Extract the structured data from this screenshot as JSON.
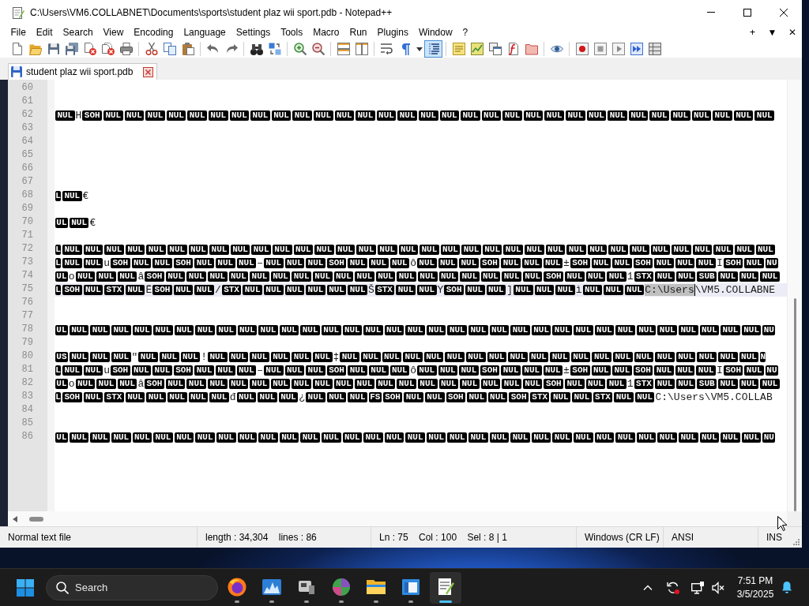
{
  "window": {
    "title": "C:\\Users\\VM6.COLLABNET\\Documents\\sports\\student plaz wii sport.pdb - Notepad++"
  },
  "menu_bar": {
    "items": [
      "File",
      "Edit",
      "Search",
      "View",
      "Encoding",
      "Language",
      "Settings",
      "Tools",
      "Macro",
      "Run",
      "Plugins",
      "Window",
      "?"
    ],
    "window_controls": [
      "+",
      "▼",
      "✕"
    ]
  },
  "toolbar": {
    "buttons": [
      {
        "pressed": false
      },
      {
        "pressed": false
      },
      {
        "pressed": false
      },
      {
        "pressed": false
      },
      {
        "pressed": false
      },
      {
        "pressed": false
      },
      {
        "pressed": false
      },
      {
        "pressed": false
      },
      {
        "pressed": false
      },
      {
        "pressed": false
      },
      {
        "pressed": false
      },
      {
        "pressed": false
      },
      {
        "pressed": false
      },
      {
        "pressed": false
      },
      {
        "pressed": false
      },
      {
        "pressed": false
      },
      {
        "pressed": false
      },
      {
        "pressed": false
      },
      {
        "pressed": false
      },
      {
        "pressed": false
      },
      {
        "pressed": false
      },
      {
        "pressed": true
      },
      {
        "pressed": false
      },
      {
        "pressed": false
      },
      {
        "pressed": false
      },
      {
        "pressed": false
      },
      {
        "pressed": false
      },
      {
        "pressed": false
      },
      {
        "pressed": false
      },
      {
        "pressed": false
      },
      {
        "pressed": false
      },
      {
        "pressed": false
      },
      {
        "pressed": false
      }
    ]
  },
  "tabs": [
    {
      "label": "student plaz wii sport.pdb",
      "selected": true
    }
  ],
  "editor": {
    "lines": [
      {
        "number": "60",
        "current": false
      },
      {
        "number": "61",
        "current": false
      },
      {
        "number": "62",
        "current": false,
        "tokens": [
          {
            "kind": "control",
            "text": "NUL"
          },
          {
            "kind": "text",
            "text": "H"
          },
          {
            "kind": "control",
            "text": "SOH"
          },
          {
            "kind": "control",
            "text": "NUL"
          },
          {
            "kind": "control",
            "text": "NUL"
          },
          {
            "kind": "control",
            "text": "NUL"
          },
          {
            "kind": "control",
            "text": "NUL"
          },
          {
            "kind": "control",
            "text": "NUL"
          },
          {
            "kind": "control",
            "text": "NUL"
          },
          {
            "kind": "control",
            "text": "NUL"
          },
          {
            "kind": "control",
            "text": "NUL"
          },
          {
            "kind": "control",
            "text": "NUL"
          },
          {
            "kind": "control",
            "text": "NUL"
          },
          {
            "kind": "control",
            "text": "NUL"
          },
          {
            "kind": "control",
            "text": "NUL"
          },
          {
            "kind": "control",
            "text": "NUL"
          },
          {
            "kind": "control",
            "text": "NUL"
          },
          {
            "kind": "control",
            "text": "NUL"
          },
          {
            "kind": "control",
            "text": "NUL"
          },
          {
            "kind": "control",
            "text": "NUL"
          },
          {
            "kind": "control",
            "text": "NUL"
          },
          {
            "kind": "control",
            "text": "NUL"
          },
          {
            "kind": "control",
            "text": "NUL"
          },
          {
            "kind": "control",
            "text": "NUL"
          },
          {
            "kind": "control",
            "text": "NUL"
          },
          {
            "kind": "control",
            "text": "NUL"
          },
          {
            "kind": "control",
            "text": "NUL"
          },
          {
            "kind": "control",
            "text": "NUL"
          },
          {
            "kind": "control",
            "text": "NUL"
          },
          {
            "kind": "control",
            "text": "NUL"
          },
          {
            "kind": "control",
            "text": "NUL"
          },
          {
            "kind": "control",
            "text": "NUL"
          },
          {
            "kind": "control",
            "text": "NUL"
          },
          {
            "kind": "control",
            "text": "NUL"
          },
          {
            "kind": "control",
            "text": "NUL"
          }
        ]
      },
      {
        "number": "63",
        "current": false
      },
      {
        "number": "64",
        "current": false
      },
      {
        "number": "65",
        "current": false
      },
      {
        "number": "66",
        "current": false
      },
      {
        "number": "67",
        "current": false
      },
      {
        "number": "68",
        "current": false,
        "tokens": [
          {
            "kind": "control",
            "text": "L"
          },
          {
            "kind": "control",
            "text": "NUL"
          },
          {
            "kind": "text",
            "text": "€"
          }
        ]
      },
      {
        "number": "69",
        "current": false
      },
      {
        "number": "70",
        "current": false,
        "tokens": [
          {
            "kind": "control",
            "text": "UL"
          },
          {
            "kind": "control",
            "text": "NUL"
          },
          {
            "kind": "text",
            "text": "€"
          }
        ]
      },
      {
        "number": "71",
        "current": false
      },
      {
        "number": "72",
        "current": false,
        "tokens": [
          {
            "kind": "control",
            "text": "L"
          },
          {
            "kind": "control",
            "text": "NUL"
          },
          {
            "kind": "control",
            "text": "NUL"
          },
          {
            "kind": "control",
            "text": "NUL"
          },
          {
            "kind": "control",
            "text": "NUL"
          },
          {
            "kind": "control",
            "text": "NUL"
          },
          {
            "kind": "control",
            "text": "NUL"
          },
          {
            "kind": "control",
            "text": "NUL"
          },
          {
            "kind": "control",
            "text": "NUL"
          },
          {
            "kind": "control",
            "text": "NUL"
          },
          {
            "kind": "control",
            "text": "NUL"
          },
          {
            "kind": "control",
            "text": "NUL"
          },
          {
            "kind": "control",
            "text": "NUL"
          },
          {
            "kind": "control",
            "text": "NUL"
          },
          {
            "kind": "control",
            "text": "NUL"
          },
          {
            "kind": "control",
            "text": "NUL"
          },
          {
            "kind": "control",
            "text": "NUL"
          },
          {
            "kind": "control",
            "text": "NUL"
          },
          {
            "kind": "control",
            "text": "NUL"
          },
          {
            "kind": "control",
            "text": "NUL"
          },
          {
            "kind": "control",
            "text": "NUL"
          },
          {
            "kind": "control",
            "text": "NUL"
          },
          {
            "kind": "control",
            "text": "NUL"
          },
          {
            "kind": "control",
            "text": "NUL"
          },
          {
            "kind": "control",
            "text": "NUL"
          },
          {
            "kind": "control",
            "text": "NUL"
          },
          {
            "kind": "control",
            "text": "NUL"
          },
          {
            "kind": "control",
            "text": "NUL"
          },
          {
            "kind": "control",
            "text": "NUL"
          },
          {
            "kind": "control",
            "text": "NUL"
          },
          {
            "kind": "control",
            "text": "NUL"
          },
          {
            "kind": "control",
            "text": "NUL"
          },
          {
            "kind": "control",
            "text": "NUL"
          },
          {
            "kind": "control",
            "text": "NUL"
          },
          {
            "kind": "control",
            "text": "NUL"
          }
        ]
      },
      {
        "number": "73",
        "current": false,
        "tokens": [
          {
            "kind": "control",
            "text": "L"
          },
          {
            "kind": "control",
            "text": "NUL"
          },
          {
            "kind": "control",
            "text": "NUL"
          },
          {
            "kind": "text",
            "text": "u"
          },
          {
            "kind": "control",
            "text": "SOH"
          },
          {
            "kind": "control",
            "text": "NUL"
          },
          {
            "kind": "control",
            "text": "NUL"
          },
          {
            "kind": "control",
            "text": "SOH"
          },
          {
            "kind": "control",
            "text": "NUL"
          },
          {
            "kind": "control",
            "text": "NUL"
          },
          {
            "kind": "control",
            "text": "NUL"
          },
          {
            "kind": "text",
            "text": "–"
          },
          {
            "kind": "control",
            "text": "NUL"
          },
          {
            "kind": "control",
            "text": "NUL"
          },
          {
            "kind": "control",
            "text": "NUL"
          },
          {
            "kind": "control",
            "text": "SOH"
          },
          {
            "kind": "control",
            "text": "NUL"
          },
          {
            "kind": "control",
            "text": "NUL"
          },
          {
            "kind": "control",
            "text": "NUL"
          },
          {
            "kind": "text",
            "text": "ô"
          },
          {
            "kind": "control",
            "text": "NUL"
          },
          {
            "kind": "control",
            "text": "NUL"
          },
          {
            "kind": "control",
            "text": "NUL"
          },
          {
            "kind": "control",
            "text": "SOH"
          },
          {
            "kind": "control",
            "text": "NUL"
          },
          {
            "kind": "control",
            "text": "NUL"
          },
          {
            "kind": "control",
            "text": "NUL"
          },
          {
            "kind": "text",
            "text": "±"
          },
          {
            "kind": "control",
            "text": "SOH"
          },
          {
            "kind": "control",
            "text": "NUL"
          },
          {
            "kind": "control",
            "text": "NUL"
          },
          {
            "kind": "control",
            "text": "SOH"
          },
          {
            "kind": "control",
            "text": "NUL"
          },
          {
            "kind": "control",
            "text": "NUL"
          },
          {
            "kind": "control",
            "text": "NUL"
          },
          {
            "kind": "text",
            "text": "I"
          },
          {
            "kind": "control",
            "text": "SOH"
          },
          {
            "kind": "control",
            "text": "NUL"
          },
          {
            "kind": "control",
            "text": "NU"
          }
        ]
      },
      {
        "number": "74",
        "current": false,
        "tokens": [
          {
            "kind": "control",
            "text": "UL"
          },
          {
            "kind": "text",
            "text": "o"
          },
          {
            "kind": "control",
            "text": "NUL"
          },
          {
            "kind": "control",
            "text": "NUL"
          },
          {
            "kind": "control",
            "text": "NUL"
          },
          {
            "kind": "text",
            "text": "â"
          },
          {
            "kind": "control",
            "text": "SOH"
          },
          {
            "kind": "control",
            "text": "NUL"
          },
          {
            "kind": "control",
            "text": "NUL"
          },
          {
            "kind": "control",
            "text": "NUL"
          },
          {
            "kind": "control",
            "text": "NUL"
          },
          {
            "kind": "control",
            "text": "NUL"
          },
          {
            "kind": "control",
            "text": "NUL"
          },
          {
            "kind": "control",
            "text": "NUL"
          },
          {
            "kind": "control",
            "text": "NUL"
          },
          {
            "kind": "control",
            "text": "NUL"
          },
          {
            "kind": "control",
            "text": "NUL"
          },
          {
            "kind": "control",
            "text": "NUL"
          },
          {
            "kind": "control",
            "text": "NUL"
          },
          {
            "kind": "control",
            "text": "NUL"
          },
          {
            "kind": "control",
            "text": "NUL"
          },
          {
            "kind": "control",
            "text": "NUL"
          },
          {
            "kind": "control",
            "text": "NUL"
          },
          {
            "kind": "control",
            "text": "NUL"
          },
          {
            "kind": "control",
            "text": "NUL"
          },
          {
            "kind": "control",
            "text": "SOH"
          },
          {
            "kind": "control",
            "text": "NUL"
          },
          {
            "kind": "control",
            "text": "NUL"
          },
          {
            "kind": "control",
            "text": "NUL"
          },
          {
            "kind": "text",
            "text": "1"
          },
          {
            "kind": "control",
            "text": "STX"
          },
          {
            "kind": "control",
            "text": "NUL"
          },
          {
            "kind": "control",
            "text": "NUL"
          },
          {
            "kind": "control",
            "text": "SUB"
          },
          {
            "kind": "control",
            "text": "NUL"
          },
          {
            "kind": "control",
            "text": "NUL"
          },
          {
            "kind": "control",
            "text": "NUL"
          }
        ]
      },
      {
        "number": "75",
        "current": true,
        "tokens": [
          {
            "kind": "control",
            "text": "L"
          },
          {
            "kind": "control",
            "text": "SOH"
          },
          {
            "kind": "control",
            "text": "NUL"
          },
          {
            "kind": "control",
            "text": "STX"
          },
          {
            "kind": "control",
            "text": "NUL"
          },
          {
            "kind": "text",
            "text": "Ë"
          },
          {
            "kind": "control",
            "text": "SOH"
          },
          {
            "kind": "control",
            "text": "NUL"
          },
          {
            "kind": "control",
            "text": "NUL"
          },
          {
            "kind": "text",
            "text": "/"
          },
          {
            "kind": "control",
            "text": "STX"
          },
          {
            "kind": "control",
            "text": "NUL"
          },
          {
            "kind": "control",
            "text": "NUL"
          },
          {
            "kind": "control",
            "text": "NUL"
          },
          {
            "kind": "control",
            "text": "NUL"
          },
          {
            "kind": "control",
            "text": "NUL"
          },
          {
            "kind": "control",
            "text": "NUL"
          },
          {
            "kind": "text",
            "text": "Š"
          },
          {
            "kind": "control",
            "text": "STX"
          },
          {
            "kind": "control",
            "text": "NUL"
          },
          {
            "kind": "control",
            "text": "NUL"
          },
          {
            "kind": "text",
            "text": "Y"
          },
          {
            "kind": "control",
            "text": "SOH"
          },
          {
            "kind": "control",
            "text": "NUL"
          },
          {
            "kind": "control",
            "text": "NUL"
          },
          {
            "kind": "text",
            "text": "]"
          },
          {
            "kind": "control",
            "text": "NUL"
          },
          {
            "kind": "control",
            "text": "NUL"
          },
          {
            "kind": "control",
            "text": "NUL"
          },
          {
            "kind": "text",
            "text": "ì"
          },
          {
            "kind": "control",
            "text": "NUL"
          },
          {
            "kind": "control",
            "text": "NUL"
          },
          {
            "kind": "control",
            "text": "NUL"
          },
          {
            "kind": "selected_text",
            "text": "C:\\Users"
          },
          {
            "kind": "caret"
          },
          {
            "kind": "text",
            "text": "\\VM5.COLLABNE"
          }
        ]
      },
      {
        "number": "76",
        "current": false
      },
      {
        "number": "77",
        "current": false
      },
      {
        "number": "78",
        "current": false,
        "tokens": [
          {
            "kind": "control",
            "text": "UL"
          },
          {
            "kind": "control",
            "text": "NUL"
          },
          {
            "kind": "control",
            "text": "NUL"
          },
          {
            "kind": "control",
            "text": "NUL"
          },
          {
            "kind": "control",
            "text": "NUL"
          },
          {
            "kind": "control",
            "text": "NUL"
          },
          {
            "kind": "control",
            "text": "NUL"
          },
          {
            "kind": "control",
            "text": "NUL"
          },
          {
            "kind": "control",
            "text": "NUL"
          },
          {
            "kind": "control",
            "text": "NUL"
          },
          {
            "kind": "control",
            "text": "NUL"
          },
          {
            "kind": "control",
            "text": "NUL"
          },
          {
            "kind": "control",
            "text": "NUL"
          },
          {
            "kind": "control",
            "text": "NUL"
          },
          {
            "kind": "control",
            "text": "NUL"
          },
          {
            "kind": "control",
            "text": "NUL"
          },
          {
            "kind": "control",
            "text": "NUL"
          },
          {
            "kind": "control",
            "text": "NUL"
          },
          {
            "kind": "control",
            "text": "NUL"
          },
          {
            "kind": "control",
            "text": "NUL"
          },
          {
            "kind": "control",
            "text": "NUL"
          },
          {
            "kind": "control",
            "text": "NUL"
          },
          {
            "kind": "control",
            "text": "NUL"
          },
          {
            "kind": "control",
            "text": "NUL"
          },
          {
            "kind": "control",
            "text": "NUL"
          },
          {
            "kind": "control",
            "text": "NUL"
          },
          {
            "kind": "control",
            "text": "NUL"
          },
          {
            "kind": "control",
            "text": "NUL"
          },
          {
            "kind": "control",
            "text": "NUL"
          },
          {
            "kind": "control",
            "text": "NUL"
          },
          {
            "kind": "control",
            "text": "NUL"
          },
          {
            "kind": "control",
            "text": "NUL"
          },
          {
            "kind": "control",
            "text": "NUL"
          },
          {
            "kind": "control",
            "text": "NUL"
          },
          {
            "kind": "control",
            "text": "NU"
          }
        ]
      },
      {
        "number": "79",
        "current": false
      },
      {
        "number": "80",
        "current": false,
        "tokens": [
          {
            "kind": "control",
            "text": "US"
          },
          {
            "kind": "control",
            "text": "NUL"
          },
          {
            "kind": "control",
            "text": "NUL"
          },
          {
            "kind": "control",
            "text": "NUL"
          },
          {
            "kind": "text",
            "text": "\""
          },
          {
            "kind": "control",
            "text": "NUL"
          },
          {
            "kind": "control",
            "text": "NUL"
          },
          {
            "kind": "control",
            "text": "NUL"
          },
          {
            "kind": "text",
            "text": "!"
          },
          {
            "kind": "control",
            "text": "NUL"
          },
          {
            "kind": "control",
            "text": "NUL"
          },
          {
            "kind": "control",
            "text": "NUL"
          },
          {
            "kind": "control",
            "text": "NUL"
          },
          {
            "kind": "control",
            "text": "NUL"
          },
          {
            "kind": "control",
            "text": "NUL"
          },
          {
            "kind": "text",
            "text": "‡"
          },
          {
            "kind": "control",
            "text": "NUL"
          },
          {
            "kind": "control",
            "text": "NUL"
          },
          {
            "kind": "control",
            "text": "NUL"
          },
          {
            "kind": "control",
            "text": "NUL"
          },
          {
            "kind": "control",
            "text": "NUL"
          },
          {
            "kind": "control",
            "text": "NUL"
          },
          {
            "kind": "control",
            "text": "NUL"
          },
          {
            "kind": "control",
            "text": "NUL"
          },
          {
            "kind": "control",
            "text": "NUL"
          },
          {
            "kind": "control",
            "text": "NUL"
          },
          {
            "kind": "control",
            "text": "NUL"
          },
          {
            "kind": "control",
            "text": "NUL"
          },
          {
            "kind": "control",
            "text": "NUL"
          },
          {
            "kind": "control",
            "text": "NUL"
          },
          {
            "kind": "control",
            "text": "NUL"
          },
          {
            "kind": "control",
            "text": "NUL"
          },
          {
            "kind": "control",
            "text": "NUL"
          },
          {
            "kind": "control",
            "text": "NUL"
          },
          {
            "kind": "control",
            "text": "NUL"
          },
          {
            "kind": "control",
            "text": "NUL"
          },
          {
            "kind": "control",
            "text": "N"
          }
        ]
      },
      {
        "number": "81",
        "current": false,
        "tokens": [
          {
            "kind": "control",
            "text": "L"
          },
          {
            "kind": "control",
            "text": "NUL"
          },
          {
            "kind": "control",
            "text": "NUL"
          },
          {
            "kind": "text",
            "text": "u"
          },
          {
            "kind": "control",
            "text": "SOH"
          },
          {
            "kind": "control",
            "text": "NUL"
          },
          {
            "kind": "control",
            "text": "NUL"
          },
          {
            "kind": "control",
            "text": "SOH"
          },
          {
            "kind": "control",
            "text": "NUL"
          },
          {
            "kind": "control",
            "text": "NUL"
          },
          {
            "kind": "control",
            "text": "NUL"
          },
          {
            "kind": "text",
            "text": "–"
          },
          {
            "kind": "control",
            "text": "NUL"
          },
          {
            "kind": "control",
            "text": "NUL"
          },
          {
            "kind": "control",
            "text": "NUL"
          },
          {
            "kind": "control",
            "text": "SOH"
          },
          {
            "kind": "control",
            "text": "NUL"
          },
          {
            "kind": "control",
            "text": "NUL"
          },
          {
            "kind": "control",
            "text": "NUL"
          },
          {
            "kind": "text",
            "text": "ô"
          },
          {
            "kind": "control",
            "text": "NUL"
          },
          {
            "kind": "control",
            "text": "NUL"
          },
          {
            "kind": "control",
            "text": "NUL"
          },
          {
            "kind": "control",
            "text": "SOH"
          },
          {
            "kind": "control",
            "text": "NUL"
          },
          {
            "kind": "control",
            "text": "NUL"
          },
          {
            "kind": "control",
            "text": "NUL"
          },
          {
            "kind": "text",
            "text": "±"
          },
          {
            "kind": "control",
            "text": "SOH"
          },
          {
            "kind": "control",
            "text": "NUL"
          },
          {
            "kind": "control",
            "text": "NUL"
          },
          {
            "kind": "control",
            "text": "SOH"
          },
          {
            "kind": "control",
            "text": "NUL"
          },
          {
            "kind": "control",
            "text": "NUL"
          },
          {
            "kind": "control",
            "text": "NUL"
          },
          {
            "kind": "text",
            "text": "I"
          },
          {
            "kind": "control",
            "text": "SOH"
          },
          {
            "kind": "control",
            "text": "NUL"
          },
          {
            "kind": "control",
            "text": "NU"
          }
        ]
      },
      {
        "number": "82",
        "current": false,
        "tokens": [
          {
            "kind": "control",
            "text": "UL"
          },
          {
            "kind": "text",
            "text": "o"
          },
          {
            "kind": "control",
            "text": "NUL"
          },
          {
            "kind": "control",
            "text": "NUL"
          },
          {
            "kind": "control",
            "text": "NUL"
          },
          {
            "kind": "text",
            "text": "â"
          },
          {
            "kind": "control",
            "text": "SOH"
          },
          {
            "kind": "control",
            "text": "NUL"
          },
          {
            "kind": "control",
            "text": "NUL"
          },
          {
            "kind": "control",
            "text": "NUL"
          },
          {
            "kind": "control",
            "text": "NUL"
          },
          {
            "kind": "control",
            "text": "NUL"
          },
          {
            "kind": "control",
            "text": "NUL"
          },
          {
            "kind": "control",
            "text": "NUL"
          },
          {
            "kind": "control",
            "text": "NUL"
          },
          {
            "kind": "control",
            "text": "NUL"
          },
          {
            "kind": "control",
            "text": "NUL"
          },
          {
            "kind": "control",
            "text": "NUL"
          },
          {
            "kind": "control",
            "text": "NUL"
          },
          {
            "kind": "control",
            "text": "NUL"
          },
          {
            "kind": "control",
            "text": "NUL"
          },
          {
            "kind": "control",
            "text": "NUL"
          },
          {
            "kind": "control",
            "text": "NUL"
          },
          {
            "kind": "control",
            "text": "NUL"
          },
          {
            "kind": "control",
            "text": "NUL"
          },
          {
            "kind": "control",
            "text": "SOH"
          },
          {
            "kind": "control",
            "text": "NUL"
          },
          {
            "kind": "control",
            "text": "NUL"
          },
          {
            "kind": "control",
            "text": "NUL"
          },
          {
            "kind": "text",
            "text": "1"
          },
          {
            "kind": "control",
            "text": "STX"
          },
          {
            "kind": "control",
            "text": "NUL"
          },
          {
            "kind": "control",
            "text": "NUL"
          },
          {
            "kind": "control",
            "text": "SUB"
          },
          {
            "kind": "control",
            "text": "NUL"
          },
          {
            "kind": "control",
            "text": "NUL"
          },
          {
            "kind": "control",
            "text": "NUL"
          }
        ]
      },
      {
        "number": "83",
        "current": false,
        "tokens": [
          {
            "kind": "control",
            "text": "L"
          },
          {
            "kind": "control",
            "text": "SOH"
          },
          {
            "kind": "control",
            "text": "NUL"
          },
          {
            "kind": "control",
            "text": "STX"
          },
          {
            "kind": "control",
            "text": "NUL"
          },
          {
            "kind": "control",
            "text": "NUL"
          },
          {
            "kind": "control",
            "text": "NUL"
          },
          {
            "kind": "control",
            "text": "NUL"
          },
          {
            "kind": "control",
            "text": "NUL"
          },
          {
            "kind": "text",
            "text": "đ"
          },
          {
            "kind": "control",
            "text": "NUL"
          },
          {
            "kind": "control",
            "text": "NUL"
          },
          {
            "kind": "control",
            "text": "NUL"
          },
          {
            "kind": "text",
            "text": "¿"
          },
          {
            "kind": "control",
            "text": "NUL"
          },
          {
            "kind": "control",
            "text": "NUL"
          },
          {
            "kind": "control",
            "text": "NUL"
          },
          {
            "kind": "control",
            "text": "FS"
          },
          {
            "kind": "control",
            "text": "SOH"
          },
          {
            "kind": "control",
            "text": "NUL"
          },
          {
            "kind": "control",
            "text": "NUL"
          },
          {
            "kind": "control",
            "text": "SOH"
          },
          {
            "kind": "control",
            "text": "NUL"
          },
          {
            "kind": "control",
            "text": "NUL"
          },
          {
            "kind": "control",
            "text": "SOH"
          },
          {
            "kind": "control",
            "text": "STX"
          },
          {
            "kind": "control",
            "text": "NUL"
          },
          {
            "kind": "control",
            "text": "NUL"
          },
          {
            "kind": "control",
            "text": "STX"
          },
          {
            "kind": "control",
            "text": "NUL"
          },
          {
            "kind": "control",
            "text": "NUL"
          },
          {
            "kind": "text",
            "text": "C:\\Users\\VM5.COLLAB"
          }
        ]
      },
      {
        "number": "84",
        "current": false
      },
      {
        "number": "85",
        "current": false
      },
      {
        "number": "86",
        "current": false,
        "tokens": [
          {
            "kind": "control",
            "text": "UL"
          },
          {
            "kind": "control",
            "text": "NUL"
          },
          {
            "kind": "control",
            "text": "NUL"
          },
          {
            "kind": "control",
            "text": "NUL"
          },
          {
            "kind": "control",
            "text": "NUL"
          },
          {
            "kind": "control",
            "text": "NUL"
          },
          {
            "kind": "control",
            "text": "NUL"
          },
          {
            "kind": "control",
            "text": "NUL"
          },
          {
            "kind": "control",
            "text": "NUL"
          },
          {
            "kind": "control",
            "text": "NUL"
          },
          {
            "kind": "control",
            "text": "NUL"
          },
          {
            "kind": "control",
            "text": "NUL"
          },
          {
            "kind": "control",
            "text": "NUL"
          },
          {
            "kind": "control",
            "text": "NUL"
          },
          {
            "kind": "control",
            "text": "NUL"
          },
          {
            "kind": "control",
            "text": "NUL"
          },
          {
            "kind": "control",
            "text": "NUL"
          },
          {
            "kind": "control",
            "text": "NUL"
          },
          {
            "kind": "control",
            "text": "NUL"
          },
          {
            "kind": "control",
            "text": "NUL"
          },
          {
            "kind": "control",
            "text": "NUL"
          },
          {
            "kind": "control",
            "text": "NUL"
          },
          {
            "kind": "control",
            "text": "NUL"
          },
          {
            "kind": "control",
            "text": "NUL"
          },
          {
            "kind": "control",
            "text": "NUL"
          },
          {
            "kind": "control",
            "text": "NUL"
          },
          {
            "kind": "control",
            "text": "NUL"
          },
          {
            "kind": "control",
            "text": "NUL"
          },
          {
            "kind": "control",
            "text": "NUL"
          },
          {
            "kind": "control",
            "text": "NUL"
          },
          {
            "kind": "control",
            "text": "NUL"
          },
          {
            "kind": "control",
            "text": "NUL"
          },
          {
            "kind": "control",
            "text": "NUL"
          },
          {
            "kind": "control",
            "text": "NUL"
          },
          {
            "kind": "control",
            "text": "NU"
          }
        ]
      }
    ]
  },
  "status_bar": {
    "file_type": "Normal text file",
    "size": "length : 34,304    lines : 86",
    "position": "Ln : 75    Col : 100    Sel : 8 | 1",
    "line_ending": "Windows (CR LF)",
    "encoding": "ANSI",
    "insert_mode": "INS"
  },
  "taskbar": {
    "search": {
      "placeholder": "Search"
    },
    "apps": [
      {
        "running": true,
        "selected": false
      },
      {
        "running": true,
        "selected": false
      },
      {
        "running": true,
        "selected": false
      },
      {
        "running": true,
        "selected": false
      },
      {
        "running": true,
        "selected": false
      },
      {
        "running": true,
        "selected": false
      },
      {
        "running": true,
        "selected": true
      }
    ],
    "clock": {
      "time": "7:51 PM",
      "date": "3/5/2025"
    }
  }
}
